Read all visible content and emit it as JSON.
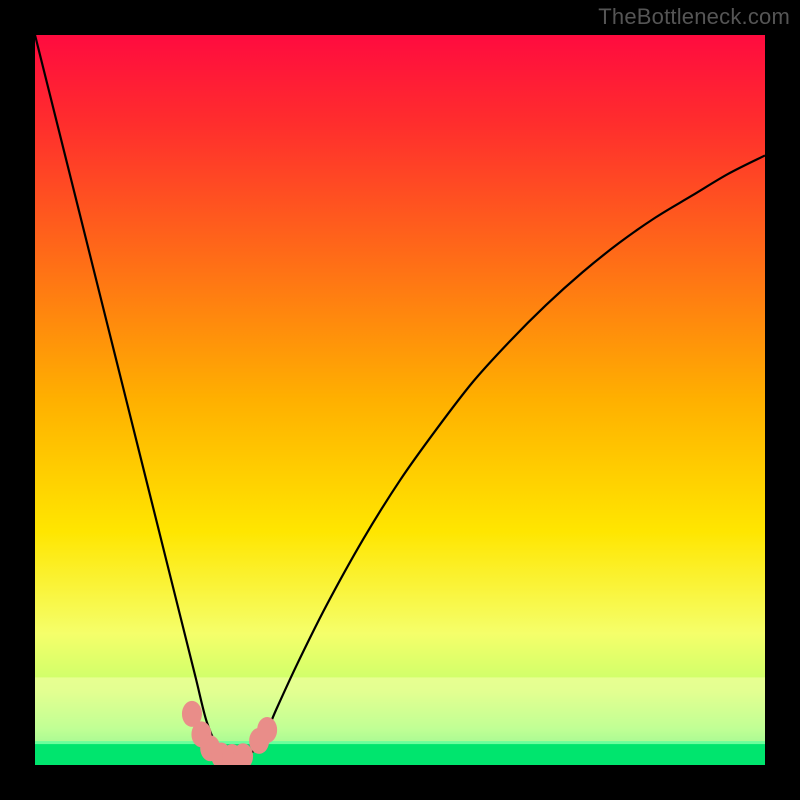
{
  "watermark": "TheBottleneck.com",
  "chart_data": {
    "type": "line",
    "title": "",
    "xlabel": "",
    "ylabel": "",
    "xlim": [
      0,
      100
    ],
    "ylim": [
      0,
      100
    ],
    "background_gradient": {
      "stops": [
        {
          "pct": 0,
          "color": "#ff0b3f"
        },
        {
          "pct": 12,
          "color": "#ff2d2d"
        },
        {
          "pct": 30,
          "color": "#ff6a18"
        },
        {
          "pct": 50,
          "color": "#ffb000"
        },
        {
          "pct": 68,
          "color": "#ffe600"
        },
        {
          "pct": 82,
          "color": "#f5ff6a"
        },
        {
          "pct": 90,
          "color": "#c6ff6a"
        },
        {
          "pct": 95,
          "color": "#7bff73"
        },
        {
          "pct": 100,
          "color": "#00e56e"
        }
      ]
    },
    "green_band": {
      "y_from": 0,
      "y_to": 3
    },
    "series": [
      {
        "name": "bottleneck-curve",
        "color": "#000000",
        "x": [
          0,
          2,
          4,
          6,
          8,
          10,
          12,
          14,
          16,
          18,
          20,
          22,
          23.5,
          25,
          26,
          27,
          28,
          29,
          30,
          31.5,
          33,
          36,
          40,
          45,
          50,
          55,
          60,
          65,
          70,
          75,
          80,
          85,
          90,
          95,
          100
        ],
        "y": [
          100,
          92,
          84,
          76,
          68,
          60,
          52,
          44,
          36,
          28,
          20,
          12,
          6,
          2.5,
          1.6,
          1.2,
          1.1,
          1.3,
          2,
          4,
          7.5,
          14,
          22,
          31,
          39,
          46,
          52.5,
          58,
          63,
          67.5,
          71.5,
          75,
          78,
          81,
          83.5
        ]
      }
    ],
    "markers": [
      {
        "x": 21.5,
        "y": 7.0
      },
      {
        "x": 22.8,
        "y": 4.2
      },
      {
        "x": 24.0,
        "y": 2.3
      },
      {
        "x": 25.5,
        "y": 1.3
      },
      {
        "x": 27.0,
        "y": 1.1
      },
      {
        "x": 28.5,
        "y": 1.2
      },
      {
        "x": 30.7,
        "y": 3.3
      },
      {
        "x": 31.8,
        "y": 4.8
      }
    ],
    "marker_style": {
      "fill": "#e98d89",
      "rx": 10,
      "ry": 13
    }
  }
}
